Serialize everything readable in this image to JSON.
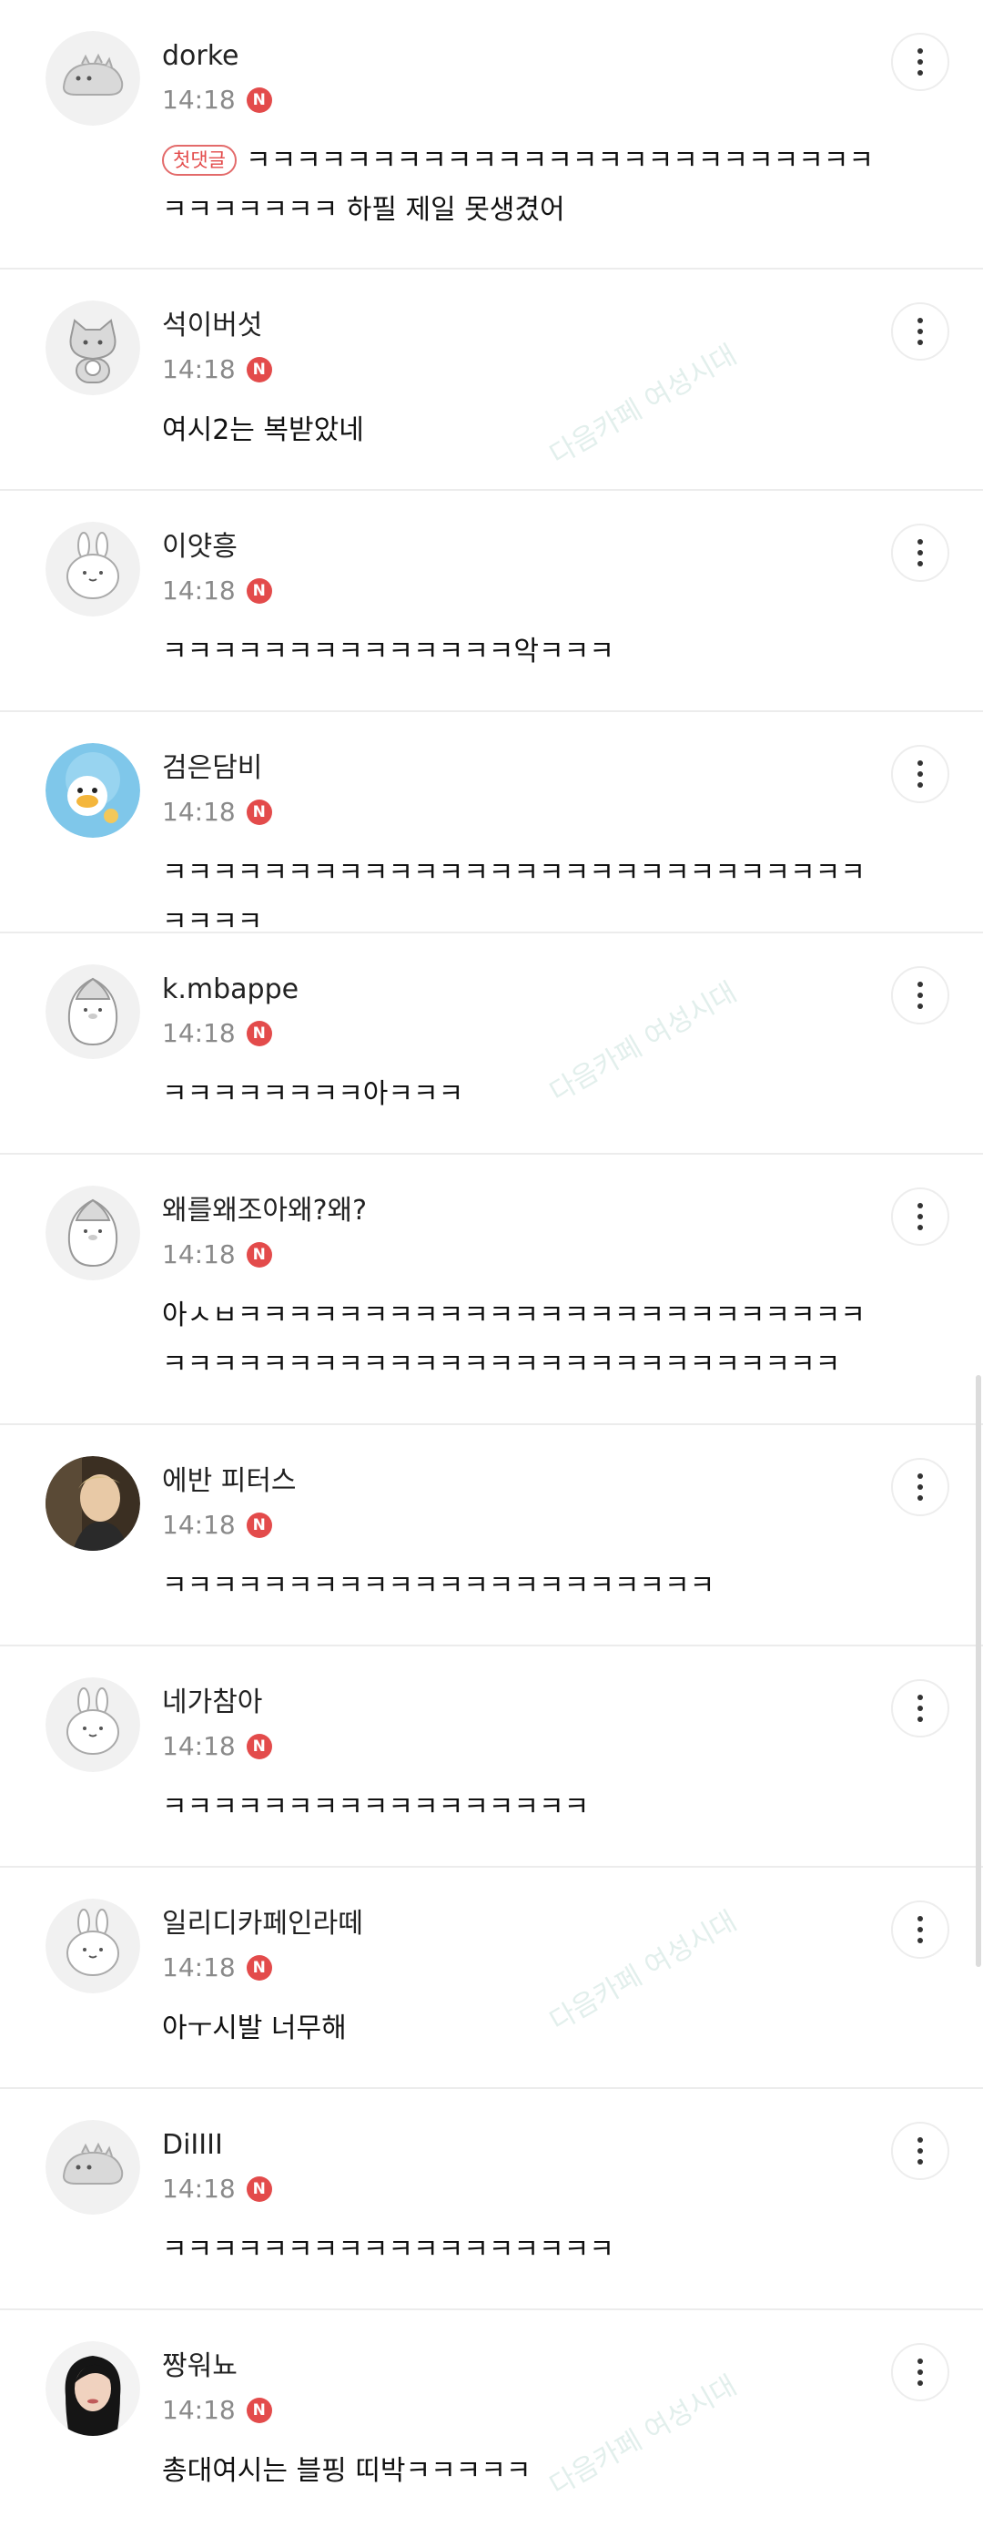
{
  "watermark_text": "다음카페 여성시대",
  "colors": {
    "new_badge": "#e34b4b",
    "first_badge": "#e34b4b",
    "divider": "#ececec"
  },
  "comments": [
    {
      "nickname": "dorke",
      "time": "14:18",
      "new_label": "N",
      "badge": "첫댓글",
      "text": "ㅋㅋㅋㅋㅋㅋㅋㅋㅋㅋㅋㅋㅋㅋㅋㅋㅋㅋㅋㅋㅋㅋㅋㅋㅋㅋㅋㅋㅋㅋㅋㅋ 하필 제일 못생겼어",
      "avatar": "dinosaur-default-avatar"
    },
    {
      "nickname": "석이버섯",
      "time": "14:18",
      "new_label": "N",
      "text": "여시2는 복받았네",
      "avatar": "cat-default-avatar"
    },
    {
      "nickname": "이얏흥",
      "time": "14:18",
      "new_label": "N",
      "text": "ㅋㅋㅋㅋㅋㅋㅋㅋㅋㅋㅋㅋㅋㅋ악ㅋㅋㅋ",
      "avatar": "rabbit-default-avatar"
    },
    {
      "nickname": "검은담비",
      "time": "14:18",
      "new_label": "N",
      "text": "ㅋㅋㅋㅋㅋㅋㅋㅋㅋㅋㅋㅋㅋㅋㅋㅋㅋㅋㅋㅋㅋㅋㅋㅋㅋㅋㅋㅋㅋㅋㅋㅋ",
      "avatar": "duck-profile-photo"
    },
    {
      "nickname": "k.mbappe",
      "time": "14:18",
      "new_label": "N",
      "text": "ㅋㅋㅋㅋㅋㅋㅋㅋ아ㅋㅋㅋ",
      "avatar": "penguin-default-avatar"
    },
    {
      "nickname": "왜를왜조아왜?왜?",
      "time": "14:18",
      "new_label": "N",
      "text": "아ㅅㅂㅋㅋㅋㅋㅋㅋㅋㅋㅋㅋㅋㅋㅋㅋㅋㅋㅋㅋㅋㅋㅋㅋㅋㅋㅋㅋㅋㅋㅋㅋㅋㅋㅋㅋㅋㅋㅋㅋㅋㅋㅋㅋㅋㅋㅋㅋㅋㅋㅋㅋㅋㅋ",
      "avatar": "penguin-default-avatar"
    },
    {
      "nickname": "에반 피터스",
      "time": "14:18",
      "new_label": "N",
      "text": "ㅋㅋㅋㅋㅋㅋㅋㅋㅋㅋㅋㅋㅋㅋㅋㅋㅋㅋㅋㅋㅋㅋ",
      "avatar": "person-profile-photo"
    },
    {
      "nickname": "네가참아",
      "time": "14:18",
      "new_label": "N",
      "text": "ㅋㅋㅋㅋㅋㅋㅋㅋㅋㅋㅋㅋㅋㅋㅋㅋㅋ",
      "avatar": "rabbit-default-avatar"
    },
    {
      "nickname": "일리디카페인라떼",
      "time": "14:18",
      "new_label": "N",
      "text": "아ㅜ시발 너무해",
      "avatar": "rabbit-default-avatar"
    },
    {
      "nickname": "DiIIII",
      "time": "14:18",
      "new_label": "N",
      "text": "ㅋㅋㅋㅋㅋㅋㅋㅋㅋㅋㅋㅋㅋㅋㅋㅋㅋㅋ",
      "avatar": "dinosaur-default-avatar"
    },
    {
      "nickname": "짱워뇨",
      "time": "14:18",
      "new_label": "N",
      "text": "총대여시는 블핑 띠박ㅋㅋㅋㅋㅋ",
      "avatar": "person-profile-photo"
    }
  ]
}
